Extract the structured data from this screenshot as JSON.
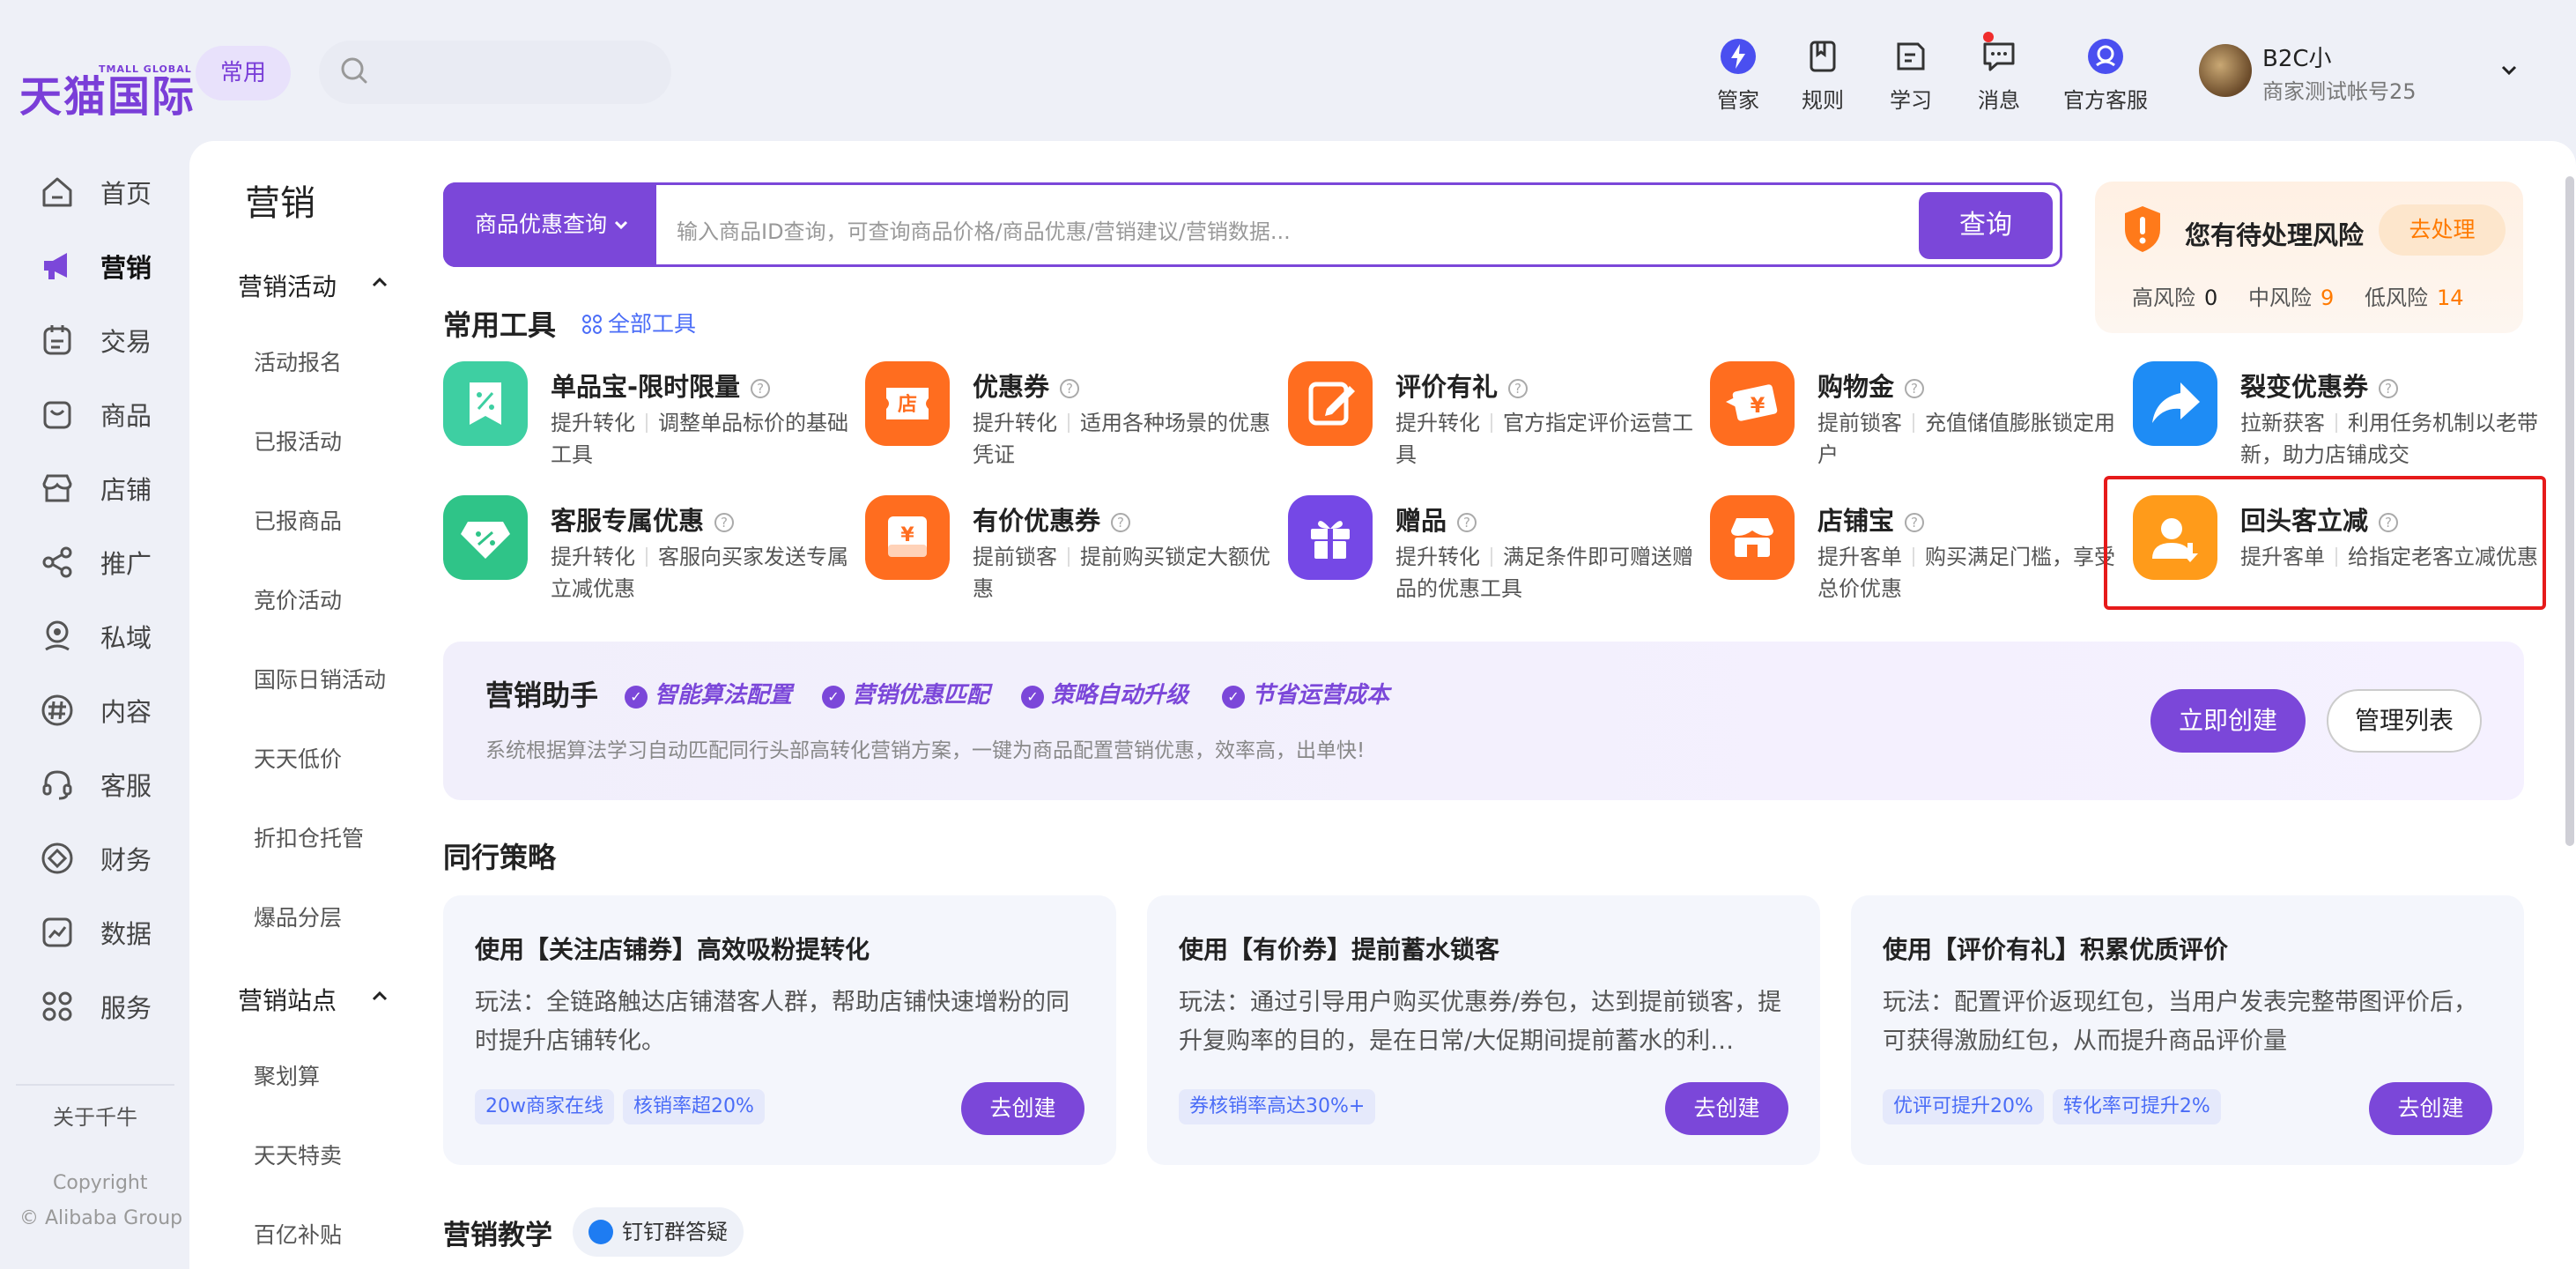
{
  "header": {
    "logo_text": "天猫国际",
    "logo_sub": "TMALL GLOBAL",
    "common_chip": "常用",
    "nav": [
      {
        "label": "管家",
        "icon": "butler-icon"
      },
      {
        "label": "规则",
        "icon": "rules-icon"
      },
      {
        "label": "学习",
        "icon": "learn-icon"
      },
      {
        "label": "消息",
        "icon": "message-icon"
      },
      {
        "label": "官方客服",
        "icon": "customer-service-icon"
      }
    ],
    "user": {
      "name": "B2C小",
      "account": "商家测试帐号25"
    }
  },
  "sidebar": {
    "items": [
      {
        "label": "首页",
        "icon": "home-icon"
      },
      {
        "label": "营销",
        "icon": "megaphone-icon"
      },
      {
        "label": "交易",
        "icon": "trade-icon"
      },
      {
        "label": "商品",
        "icon": "bag-icon"
      },
      {
        "label": "店铺",
        "icon": "shop-icon"
      },
      {
        "label": "推广",
        "icon": "share-icon"
      },
      {
        "label": "私域",
        "icon": "private-domain-icon"
      },
      {
        "label": "内容",
        "icon": "hash-icon"
      },
      {
        "label": "客服",
        "icon": "headset-icon"
      },
      {
        "label": "财务",
        "icon": "finance-icon"
      },
      {
        "label": "数据",
        "icon": "chart-icon"
      },
      {
        "label": "服务",
        "icon": "grid-icon"
      }
    ],
    "about": "关于千牛",
    "copyright": "Copyright",
    "copyright2": "© Alibaba Group"
  },
  "subnav": {
    "title": "营销",
    "group1": "营销活动",
    "group1_items": [
      "活动报名",
      "已报活动",
      "已报商品",
      "竞价活动",
      "国际日销活动",
      "天天低价",
      "折扣仓托管",
      "爆品分层"
    ],
    "group2": "营销站点",
    "group2_items": [
      "聚划算",
      "天天特卖",
      "百亿补贴"
    ]
  },
  "search": {
    "category": "商品优惠查询",
    "placeholder": "输入商品ID查询，可查询商品价格/商品优惠/营销建议/营销数据...",
    "button": "查询"
  },
  "risk": {
    "title": "您有待处理风险",
    "action": "去处理",
    "high_label": "高风险",
    "high_count": "0",
    "mid_label": "中风险",
    "mid_count": "9",
    "low_label": "低风险",
    "low_count": "14"
  },
  "tools": {
    "title": "常用工具",
    "all_link": "全部工具",
    "items": [
      {
        "name": "单品宝-限时限量",
        "tag": "提升转化",
        "desc": "调整单品标价的基础工具",
        "color": "#3ecfa2"
      },
      {
        "name": "优惠券",
        "tag": "提升转化",
        "desc": "适用各种场景的优惠凭证",
        "color": "#ff6d1f"
      },
      {
        "name": "评价有礼",
        "tag": "提升转化",
        "desc": "官方指定评价运营工具",
        "color": "#ff6d1f"
      },
      {
        "name": "购物金",
        "tag": "提前锁客",
        "desc": "充值储值膨胀锁定用户",
        "color": "#ff6d1f"
      },
      {
        "name": "裂变优惠券",
        "tag": "拉新获客",
        "desc": "利用任务机制以老带新，助力店铺成交",
        "color": "#1e8cf5"
      },
      {
        "name": "客服专属优惠",
        "tag": "提升转化",
        "desc": "客服向买家发送专属立减优惠",
        "color": "#2fc488"
      },
      {
        "name": "有价优惠券",
        "tag": "提前锁客",
        "desc": "提前购买锁定大额优惠",
        "color": "#ff6d1f"
      },
      {
        "name": "赠品",
        "tag": "提升转化",
        "desc": "满足条件即可赠送赠品的优惠工具",
        "color": "#7548e6"
      },
      {
        "name": "店铺宝",
        "tag": "提升客单",
        "desc": "购买满足门槛，享受总价优惠",
        "color": "#ff6d1f"
      },
      {
        "name": "回头客立减",
        "tag": "提升客单",
        "desc": "给指定老客立减优惠",
        "color": "#ff9b1a"
      }
    ]
  },
  "assistant": {
    "title": "营销助手",
    "features": [
      "智能算法配置",
      "营销优惠匹配",
      "策略自动升级",
      "节省运营成本"
    ],
    "desc": "系统根据算法学习自动匹配同行头部高转化营销方案，一键为商品配置营销优惠，效率高，出单快!",
    "create_now": "立即创建",
    "manage_list": "管理列表"
  },
  "peers": {
    "title": "同行策略",
    "cards": [
      {
        "title": "使用【关注店铺券】高效吸粉提转化",
        "desc": "玩法：全链路触达店铺潜客人群，帮助店铺快速增粉的同时提升店铺转化。",
        "tags": [
          "20w商家在线",
          "核销率超20%"
        ],
        "button": "去创建"
      },
      {
        "title": "使用【有价券】提前蓄水锁客",
        "desc": "玩法：通过引导用户购买优惠券/券包，达到提前锁客，提升复购率的目的，是在日常/大促期间提前蓄水的利…",
        "tags": [
          "券核销率高达30%+"
        ],
        "button": "去创建"
      },
      {
        "title": "使用【评价有礼】积累优质评价",
        "desc": "玩法：配置评价返现红包，当用户发表完整带图评价后，可获得激励红包，从而提升商品评价量",
        "tags": [
          "优评可提升20%",
          "转化率可提升2%"
        ],
        "button": "去创建"
      }
    ]
  },
  "teaching": {
    "title": "营销教学",
    "dingtalk": "钉钉群答疑"
  }
}
